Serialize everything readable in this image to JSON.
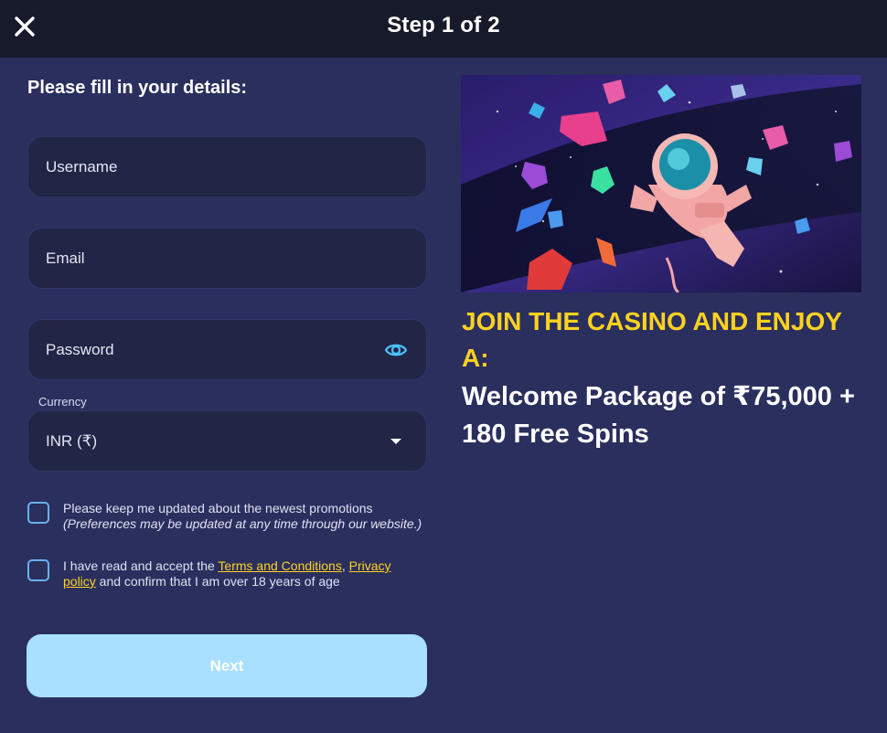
{
  "header": {
    "title": "Step 1 of 2",
    "close_icon": "close-icon"
  },
  "form": {
    "heading": "Please fill in your details:",
    "username": {
      "placeholder": "Username",
      "value": ""
    },
    "email": {
      "placeholder": "Email",
      "value": ""
    },
    "password": {
      "placeholder": "Password",
      "value": "",
      "toggle_icon": "eye-icon"
    },
    "currency": {
      "label": "Currency",
      "selected": "INR (₹)",
      "icon": "caret-down-icon"
    },
    "promotions_checkbox": {
      "checked": false,
      "text": "Please keep me updated about the newest promotions",
      "note": "(Preferences may be updated at any time through our website.)"
    },
    "terms_checkbox": {
      "checked": false,
      "text_before": "I have read and accept the ",
      "terms_link": "Terms and Conditions",
      "comma": ", ",
      "privacy_link": "Privacy policy",
      "text_after": " and confirm that I am over 18 years of age"
    },
    "next_label": "Next"
  },
  "promo": {
    "image_description_icon": "astronaut-gems-illustration",
    "headline": "JOIN THE CASINO AND ENJOY A:",
    "offer": "Welcome Package of ₹75,000 + 180 Free Spins"
  },
  "colors": {
    "background": "#2a2f5e",
    "topbar": "#171a2a",
    "field_bg": "#212546",
    "accent_yellow": "#ffd21f",
    "button_bg": "#a9e0ff",
    "eye_icon": "#4cc3f5",
    "checkbox_border": "#6ab0f0"
  }
}
